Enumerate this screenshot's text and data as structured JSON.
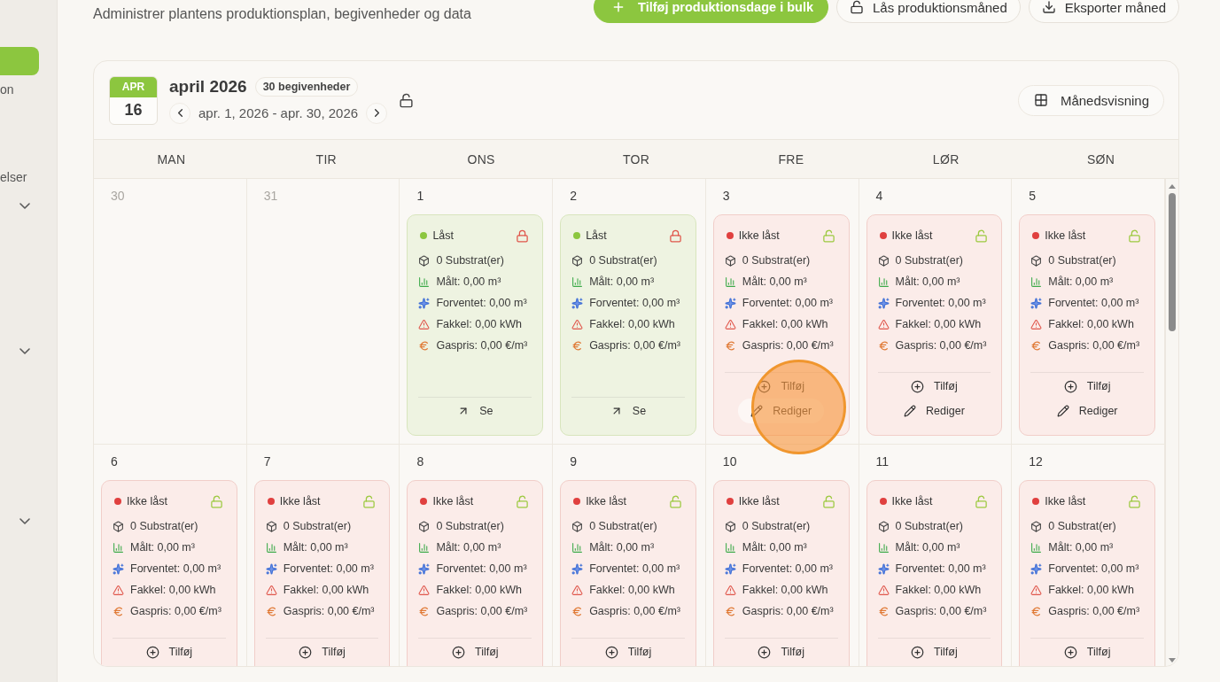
{
  "sidebar": {
    "items": [
      {
        "kind": "link",
        "selected": true
      },
      {
        "kind": "link",
        "label": "on",
        "selected": false
      },
      {
        "kind": "link",
        "label": "elser",
        "selected": false
      },
      {
        "kind": "group",
        "expanded": false
      },
      {
        "kind": "group",
        "expanded": false
      },
      {
        "kind": "group",
        "expanded": false
      }
    ]
  },
  "header": {
    "subtitle": "Administrer plantens produktionsplan, begivenheder og data",
    "actions": [
      {
        "kind": "add",
        "label": "Tilføj produktionsdage i bulk"
      },
      {
        "kind": "lock",
        "label": "Lås produktionsmåned"
      },
      {
        "kind": "export",
        "label": "Eksporter måned"
      }
    ]
  },
  "calendar": {
    "badge": {
      "month": "APR",
      "day": "16"
    },
    "title": "april 2026",
    "event_count": "30 begivenheder",
    "range": "apr. 1, 2026 - apr. 30, 2026",
    "locked": false,
    "view_button": "Månedsvisning",
    "weekdays": [
      "MAN",
      "TIR",
      "ONS",
      "TOR",
      "FRE",
      "LØR",
      "SØN"
    ],
    "weeks": [
      [
        {
          "number": "30",
          "in_month": false
        },
        {
          "number": "31",
          "in_month": false
        },
        {
          "number": "1",
          "in_month": true,
          "entry": {
            "locked": true,
            "status": "Låst",
            "metrics": [
              {
                "kind": "substrate",
                "text": "0 Substrat(er)"
              },
              {
                "kind": "measured",
                "text": "Målt: 0,00 m³"
              },
              {
                "kind": "expected",
                "text": "Forventet: 0,00 m³"
              },
              {
                "kind": "flare",
                "text": "Fakkel: 0,00 kWh"
              },
              {
                "kind": "price",
                "text": "Gaspris: 0,00 €/m³"
              }
            ],
            "actions": [
              {
                "kind": "view",
                "label": "Se",
                "hovered": false
              }
            ]
          }
        },
        {
          "number": "2",
          "in_month": true,
          "entry": {
            "locked": true,
            "status": "Låst",
            "metrics": [
              {
                "kind": "substrate",
                "text": "0 Substrat(er)"
              },
              {
                "kind": "measured",
                "text": "Målt: 0,00 m³"
              },
              {
                "kind": "expected",
                "text": "Forventet: 0,00 m³"
              },
              {
                "kind": "flare",
                "text": "Fakkel: 0,00 kWh"
              },
              {
                "kind": "price",
                "text": "Gaspris: 0,00 €/m³"
              }
            ],
            "actions": [
              {
                "kind": "view",
                "label": "Se",
                "hovered": false
              }
            ]
          }
        },
        {
          "number": "3",
          "in_month": true,
          "entry": {
            "locked": false,
            "status": "Ikke låst",
            "metrics": [
              {
                "kind": "substrate",
                "text": "0 Substrat(er)"
              },
              {
                "kind": "measured",
                "text": "Målt: 0,00 m³"
              },
              {
                "kind": "expected",
                "text": "Forventet: 0,00 m³"
              },
              {
                "kind": "flare",
                "text": "Fakkel: 0,00 kWh"
              },
              {
                "kind": "price",
                "text": "Gaspris: 0,00 €/m³"
              }
            ],
            "actions": [
              {
                "kind": "add",
                "label": "Tilføj",
                "hovered": false
              },
              {
                "kind": "edit",
                "label": "Rediger",
                "hovered": true
              }
            ]
          }
        },
        {
          "number": "4",
          "in_month": true,
          "entry": {
            "locked": false,
            "status": "Ikke låst",
            "metrics": [
              {
                "kind": "substrate",
                "text": "0 Substrat(er)"
              },
              {
                "kind": "measured",
                "text": "Målt: 0,00 m³"
              },
              {
                "kind": "expected",
                "text": "Forventet: 0,00 m³"
              },
              {
                "kind": "flare",
                "text": "Fakkel: 0,00 kWh"
              },
              {
                "kind": "price",
                "text": "Gaspris: 0,00 €/m³"
              }
            ],
            "actions": [
              {
                "kind": "add",
                "label": "Tilføj",
                "hovered": false
              },
              {
                "kind": "edit",
                "label": "Rediger",
                "hovered": false
              }
            ]
          }
        },
        {
          "number": "5",
          "in_month": true,
          "entry": {
            "locked": false,
            "status": "Ikke låst",
            "metrics": [
              {
                "kind": "substrate",
                "text": "0 Substrat(er)"
              },
              {
                "kind": "measured",
                "text": "Målt: 0,00 m³"
              },
              {
                "kind": "expected",
                "text": "Forventet: 0,00 m³"
              },
              {
                "kind": "flare",
                "text": "Fakkel: 0,00 kWh"
              },
              {
                "kind": "price",
                "text": "Gaspris: 0,00 €/m³"
              }
            ],
            "actions": [
              {
                "kind": "add",
                "label": "Tilføj",
                "hovered": false
              },
              {
                "kind": "edit",
                "label": "Rediger",
                "hovered": false
              }
            ]
          }
        }
      ],
      [
        {
          "number": "6",
          "in_month": true,
          "entry": {
            "locked": false,
            "status": "Ikke låst",
            "metrics": [
              {
                "kind": "substrate",
                "text": "0 Substrat(er)"
              },
              {
                "kind": "measured",
                "text": "Målt: 0,00 m³"
              },
              {
                "kind": "expected",
                "text": "Forventet: 0,00 m³"
              },
              {
                "kind": "flare",
                "text": "Fakkel: 0,00 kWh"
              },
              {
                "kind": "price",
                "text": "Gaspris: 0,00 €/m³"
              }
            ],
            "actions": [
              {
                "kind": "add",
                "label": "Tilføj",
                "hovered": false
              }
            ]
          }
        },
        {
          "number": "7",
          "in_month": true,
          "entry": {
            "locked": false,
            "status": "Ikke låst",
            "metrics": [
              {
                "kind": "substrate",
                "text": "0 Substrat(er)"
              },
              {
                "kind": "measured",
                "text": "Målt: 0,00 m³"
              },
              {
                "kind": "expected",
                "text": "Forventet: 0,00 m³"
              },
              {
                "kind": "flare",
                "text": "Fakkel: 0,00 kWh"
              },
              {
                "kind": "price",
                "text": "Gaspris: 0,00 €/m³"
              }
            ],
            "actions": [
              {
                "kind": "add",
                "label": "Tilføj",
                "hovered": false
              }
            ]
          }
        },
        {
          "number": "8",
          "in_month": true,
          "entry": {
            "locked": false,
            "status": "Ikke låst",
            "metrics": [
              {
                "kind": "substrate",
                "text": "0 Substrat(er)"
              },
              {
                "kind": "measured",
                "text": "Målt: 0,00 m³"
              },
              {
                "kind": "expected",
                "text": "Forventet: 0,00 m³"
              },
              {
                "kind": "flare",
                "text": "Fakkel: 0,00 kWh"
              },
              {
                "kind": "price",
                "text": "Gaspris: 0,00 €/m³"
              }
            ],
            "actions": [
              {
                "kind": "add",
                "label": "Tilføj",
                "hovered": false
              }
            ]
          }
        },
        {
          "number": "9",
          "in_month": true,
          "entry": {
            "locked": false,
            "status": "Ikke låst",
            "metrics": [
              {
                "kind": "substrate",
                "text": "0 Substrat(er)"
              },
              {
                "kind": "measured",
                "text": "Målt: 0,00 m³"
              },
              {
                "kind": "expected",
                "text": "Forventet: 0,00 m³"
              },
              {
                "kind": "flare",
                "text": "Fakkel: 0,00 kWh"
              },
              {
                "kind": "price",
                "text": "Gaspris: 0,00 €/m³"
              }
            ],
            "actions": [
              {
                "kind": "add",
                "label": "Tilføj",
                "hovered": false
              }
            ]
          }
        },
        {
          "number": "10",
          "in_month": true,
          "entry": {
            "locked": false,
            "status": "Ikke låst",
            "metrics": [
              {
                "kind": "substrate",
                "text": "0 Substrat(er)"
              },
              {
                "kind": "measured",
                "text": "Målt: 0,00 m³"
              },
              {
                "kind": "expected",
                "text": "Forventet: 0,00 m³"
              },
              {
                "kind": "flare",
                "text": "Fakkel: 0,00 kWh"
              },
              {
                "kind": "price",
                "text": "Gaspris: 0,00 €/m³"
              }
            ],
            "actions": [
              {
                "kind": "add",
                "label": "Tilføj",
                "hovered": false
              }
            ]
          }
        },
        {
          "number": "11",
          "in_month": true,
          "entry": {
            "locked": false,
            "status": "Ikke låst",
            "metrics": [
              {
                "kind": "substrate",
                "text": "0 Substrat(er)"
              },
              {
                "kind": "measured",
                "text": "Målt: 0,00 m³"
              },
              {
                "kind": "expected",
                "text": "Forventet: 0,00 m³"
              },
              {
                "kind": "flare",
                "text": "Fakkel: 0,00 kWh"
              },
              {
                "kind": "price",
                "text": "Gaspris: 0,00 €/m³"
              }
            ],
            "actions": [
              {
                "kind": "add",
                "label": "Tilføj",
                "hovered": false
              }
            ]
          }
        },
        {
          "number": "12",
          "in_month": true,
          "entry": {
            "locked": false,
            "status": "Ikke låst",
            "metrics": [
              {
                "kind": "substrate",
                "text": "0 Substrat(er)"
              },
              {
                "kind": "measured",
                "text": "Målt: 0,00 m³"
              },
              {
                "kind": "expected",
                "text": "Forventet: 0,00 m³"
              },
              {
                "kind": "flare",
                "text": "Fakkel: 0,00 kWh"
              },
              {
                "kind": "price",
                "text": "Gaspris: 0,00 €/m³"
              }
            ],
            "actions": [
              {
                "kind": "add",
                "label": "Tilføj",
                "hovered": false
              }
            ]
          }
        }
      ]
    ]
  }
}
